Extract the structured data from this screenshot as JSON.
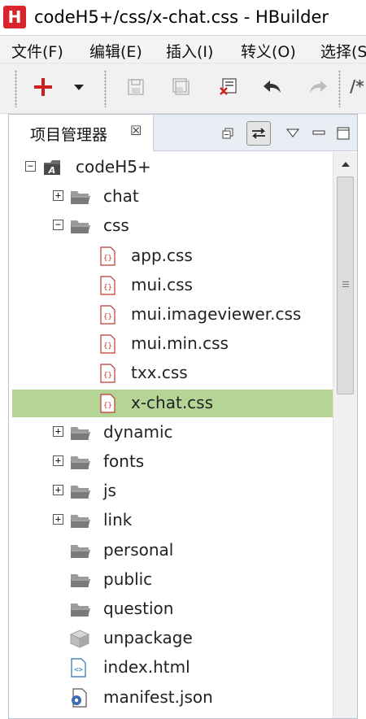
{
  "window": {
    "app_badge": "H",
    "title": "codeH5+/css/x-chat.css  -  HBuilder"
  },
  "menu": [
    {
      "label": "文件(F)"
    },
    {
      "label": "编辑(E)"
    },
    {
      "label": "插入(I)"
    },
    {
      "label": "转义(O)"
    },
    {
      "label": "选择(S"
    }
  ],
  "toolbar": {
    "new_icon": "plus-icon",
    "dropdown_icon": "caret-down-icon",
    "save_icon": "save-icon",
    "save_all_icon": "save-all-icon",
    "close_icon": "close-file-icon",
    "undo_icon": "undo-icon",
    "redo_icon": "redo-icon",
    "comment_label": "/*"
  },
  "panel": {
    "tab_label": "项目管理器",
    "tab_close": "☒"
  },
  "tree": [
    {
      "label": "codeH5+",
      "type": "project",
      "level": 0,
      "expander": "minus"
    },
    {
      "label": "chat",
      "type": "folder",
      "level": 1,
      "expander": "plus"
    },
    {
      "label": "css",
      "type": "folder",
      "level": 1,
      "expander": "minus"
    },
    {
      "label": "app.css",
      "type": "css",
      "level": 2
    },
    {
      "label": "mui.css",
      "type": "css",
      "level": 2
    },
    {
      "label": "mui.imageviewer.css",
      "type": "css",
      "level": 2
    },
    {
      "label": "mui.min.css",
      "type": "css",
      "level": 2
    },
    {
      "label": "txx.css",
      "type": "css",
      "level": 2
    },
    {
      "label": "x-chat.css",
      "type": "css",
      "level": 2,
      "selected": true
    },
    {
      "label": "dynamic",
      "type": "folder",
      "level": 1,
      "expander": "plus"
    },
    {
      "label": "fonts",
      "type": "folder",
      "level": 1,
      "expander": "plus"
    },
    {
      "label": "js",
      "type": "folder",
      "level": 1,
      "expander": "plus"
    },
    {
      "label": "link",
      "type": "folder",
      "level": 1,
      "expander": "plus"
    },
    {
      "label": "personal",
      "type": "folder",
      "level": 1
    },
    {
      "label": "public",
      "type": "folder",
      "level": 1
    },
    {
      "label": "question",
      "type": "folder",
      "level": 1
    },
    {
      "label": "unpackage",
      "type": "package",
      "level": 1
    },
    {
      "label": "index.html",
      "type": "html",
      "level": 1
    },
    {
      "label": "manifest.json",
      "type": "json",
      "level": 1
    }
  ],
  "colors": {
    "selection": "#b5d596",
    "brand_red": "#d8242a"
  }
}
